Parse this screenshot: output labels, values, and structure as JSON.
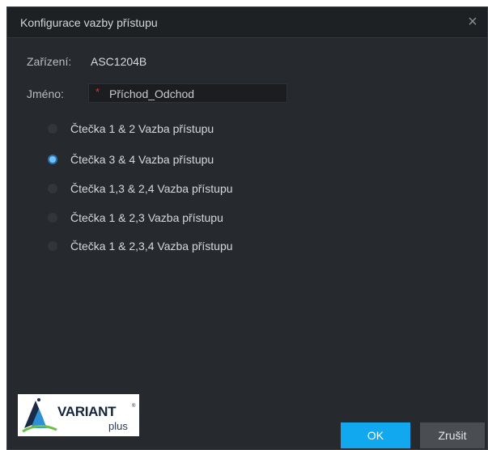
{
  "dialog": {
    "title": "Konfigurace vazby přístupu",
    "close_glyph": "×"
  },
  "device": {
    "label": "Zařízení:",
    "value": "ASC1204B"
  },
  "name": {
    "label": "Jméno:",
    "required_mark": "*",
    "value": "Příchod_Odchod"
  },
  "options": [
    {
      "label": "Čtečka 1 & 2 Vazba přístupu",
      "checked": false
    },
    {
      "label": "Čtečka 3 & 4 Vazba přístupu",
      "checked": true
    },
    {
      "label": "Čtečka 1,3 & 2,4 Vazba přístupu",
      "checked": false
    },
    {
      "label": "Čtečka 1 & 2,3 Vazba přístupu",
      "checked": false
    },
    {
      "label": "Čtečka 1 & 2,3,4 Vazba přístupu",
      "checked": false
    }
  ],
  "logo": {
    "main": "VARIANT",
    "reg": "®",
    "sub": "plus"
  },
  "buttons": {
    "ok": "OK",
    "cancel": "Zrušit"
  },
  "colors": {
    "background": "#26292d",
    "accent": "#12a8f0",
    "required": "#e0342e"
  }
}
